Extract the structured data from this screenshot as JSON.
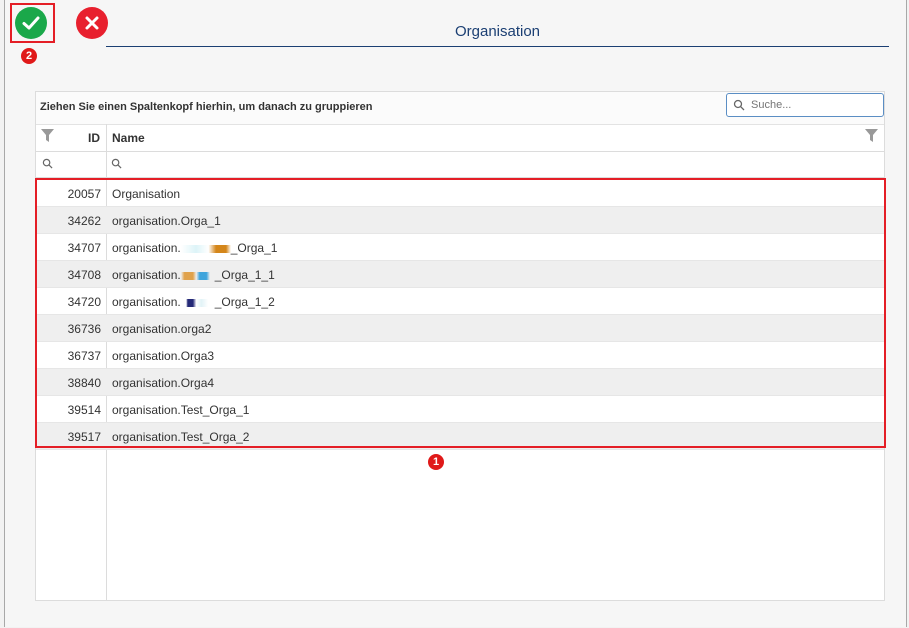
{
  "dialog": {
    "title": "Organisation",
    "ok_icon": "check-icon",
    "cancel_icon": "close-icon"
  },
  "annotations": {
    "badge_1": "1",
    "badge_2": "2"
  },
  "grid": {
    "group_hint": "Ziehen Sie einen Spaltenkopf hierhin, um danach zu gruppieren",
    "search_placeholder": "Suche...",
    "columns": {
      "id": "ID",
      "name": "Name"
    },
    "rows": [
      {
        "id": "20057",
        "name": "Organisation"
      },
      {
        "id": "34262",
        "name": "organisation.Orga_1"
      },
      {
        "id": "34707",
        "name_prefix": "organisation.",
        "name_suffix": "_Orga_1"
      },
      {
        "id": "34708",
        "name_prefix": "organisation.",
        "name_suffix": "_Orga_1_1"
      },
      {
        "id": "34720",
        "name_prefix": "organisation.",
        "name_suffix": "_Orga_1_2"
      },
      {
        "id": "36736",
        "name": "organisation.orga2"
      },
      {
        "id": "36737",
        "name": "organisation.Orga3"
      },
      {
        "id": "38840",
        "name": "organisation.Orga4"
      },
      {
        "id": "39514",
        "name": "organisation.Test_Orga_1"
      },
      {
        "id": "39517",
        "name": "organisation.Test_Orga_2"
      }
    ]
  },
  "colors": {
    "accent": "#1b3f73",
    "ok": "#1aa84a",
    "cancel": "#e8202e",
    "annotation": "#e41e26"
  }
}
